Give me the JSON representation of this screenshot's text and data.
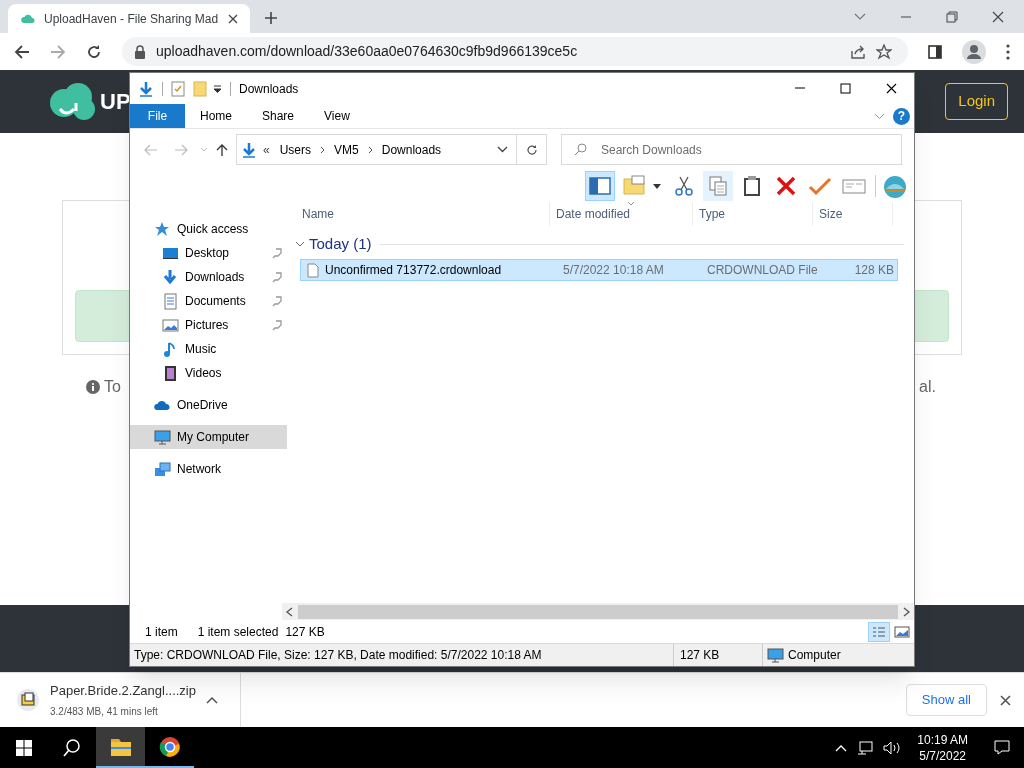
{
  "browser": {
    "tab": {
      "title": "UploadHaven - File Sharing Mad",
      "selected": true
    },
    "address": "uploadhaven.com/download/33e60aa0e0764630c9fb9d966139ce5c"
  },
  "page": {
    "logo_text": "UP",
    "login": "Login",
    "info_left": "To",
    "info_right": "al."
  },
  "explorer": {
    "title": "Downloads",
    "ribbon_tabs": [
      {
        "label": "File",
        "selected": true
      },
      {
        "label": "Home",
        "selected": false
      },
      {
        "label": "Share",
        "selected": false
      },
      {
        "label": "View",
        "selected": false
      }
    ],
    "help": "?",
    "breadcrumb_overflow": "«",
    "breadcrumb": [
      "Users",
      "VM5",
      "Downloads"
    ],
    "search": {
      "placeholder": "Search Downloads"
    },
    "nav_pane": [
      {
        "label": "Quick access",
        "selected": false,
        "children": [
          {
            "label": "Desktop",
            "pinned": true,
            "selected": false
          },
          {
            "label": "Downloads",
            "pinned": true,
            "selected": false
          },
          {
            "label": "Documents",
            "pinned": true,
            "selected": false
          },
          {
            "label": "Pictures",
            "pinned": true,
            "selected": false
          },
          {
            "label": "Music",
            "pinned": false,
            "selected": false
          },
          {
            "label": "Videos",
            "pinned": false,
            "selected": false
          }
        ]
      },
      {
        "label": "OneDrive",
        "selected": false
      },
      {
        "label": "My Computer",
        "selected": true
      },
      {
        "label": "Network",
        "selected": false
      }
    ],
    "columns": [
      "Name",
      "Date modified",
      "Type",
      "Size"
    ],
    "group": {
      "label": "Today (1)",
      "expanded": true
    },
    "files": [
      {
        "name": "Unconfirmed 713772.crdownload",
        "date": "5/7/2022 10:18 AM",
        "type": "CRDOWNLOAD File",
        "size": "128 KB",
        "selected": true
      }
    ],
    "status": {
      "items": "1 item",
      "selection": "1 item selected",
      "selection_size": "127 KB"
    },
    "details_bar": {
      "info": "Type: CRDOWNLOAD File, Size: 127 KB, Date modified: 5/7/2022 10:18 AM",
      "size": "127 KB",
      "location": "Computer"
    }
  },
  "download_bar": {
    "file": "Paper.Bride.2.Zangl....zip",
    "progress": "3.2/483 MB, 41 mins left",
    "show_all": "Show all"
  },
  "taskbar": {
    "apps": [
      {
        "selected": true
      },
      {
        "selected": false
      }
    ],
    "time": "10:19 AM",
    "date": "5/7/2022"
  }
}
